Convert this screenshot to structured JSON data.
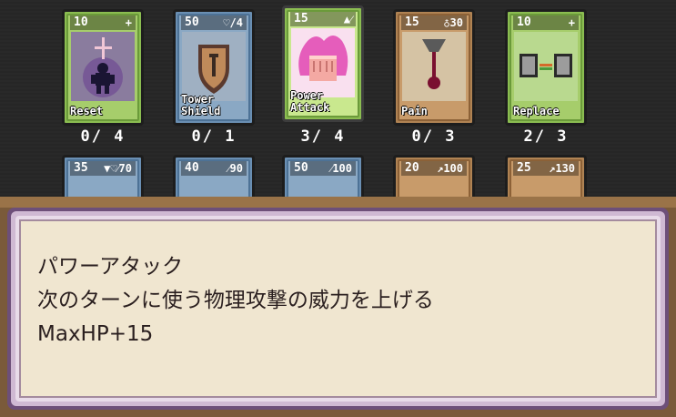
{
  "hand": [
    {
      "cost": "10",
      "symbol": "+",
      "title": [
        "Reset"
      ],
      "count": "0/ 4",
      "color": "green"
    },
    {
      "cost": "50",
      "symbol": "♡/4",
      "title": [
        "Tower",
        "Shield"
      ],
      "count": "0/ 1",
      "color": "blue"
    },
    {
      "cost": "15",
      "symbol": "▲⁄",
      "title": [
        "Power",
        "Attack"
      ],
      "count": "3/ 4",
      "color": "green",
      "selected": true
    },
    {
      "cost": "15",
      "symbol": "♁30",
      "title": [
        "Pain"
      ],
      "count": "0/ 3",
      "color": "brown"
    },
    {
      "cost": "10",
      "symbol": "+",
      "title": [
        "Replace"
      ],
      "count": "2/ 3",
      "color": "green"
    }
  ],
  "row2": [
    {
      "cost": "35",
      "symbol": "▼♡⁄70",
      "color": "blue"
    },
    {
      "cost": "40",
      "symbol": "⁄90",
      "color": "blue"
    },
    {
      "cost": "50",
      "symbol": "⁄100",
      "color": "blue"
    },
    {
      "cost": "20",
      "symbol": "↗100",
      "color": "brown"
    },
    {
      "cost": "25",
      "symbol": "↗130",
      "color": "brown"
    }
  ],
  "dialog": {
    "line1": "パワーアタック",
    "line2": "次のターンに使う物理攻撃の威力を上げる",
    "line3": "MaxHP+15"
  },
  "colors": {
    "green": "#8bbd51",
    "blue": "#6a8fb3",
    "brown": "#b08353",
    "dialog_border": "#6d4f79",
    "dialog_bg": "#f0e6d0"
  },
  "icons": {
    "reset": "dark-figure-icon",
    "tower_shield": "shield-icon",
    "power_attack": "pink-fist-icon",
    "pain": "blood-drop-icon",
    "replace": "swap-cards-icon"
  }
}
